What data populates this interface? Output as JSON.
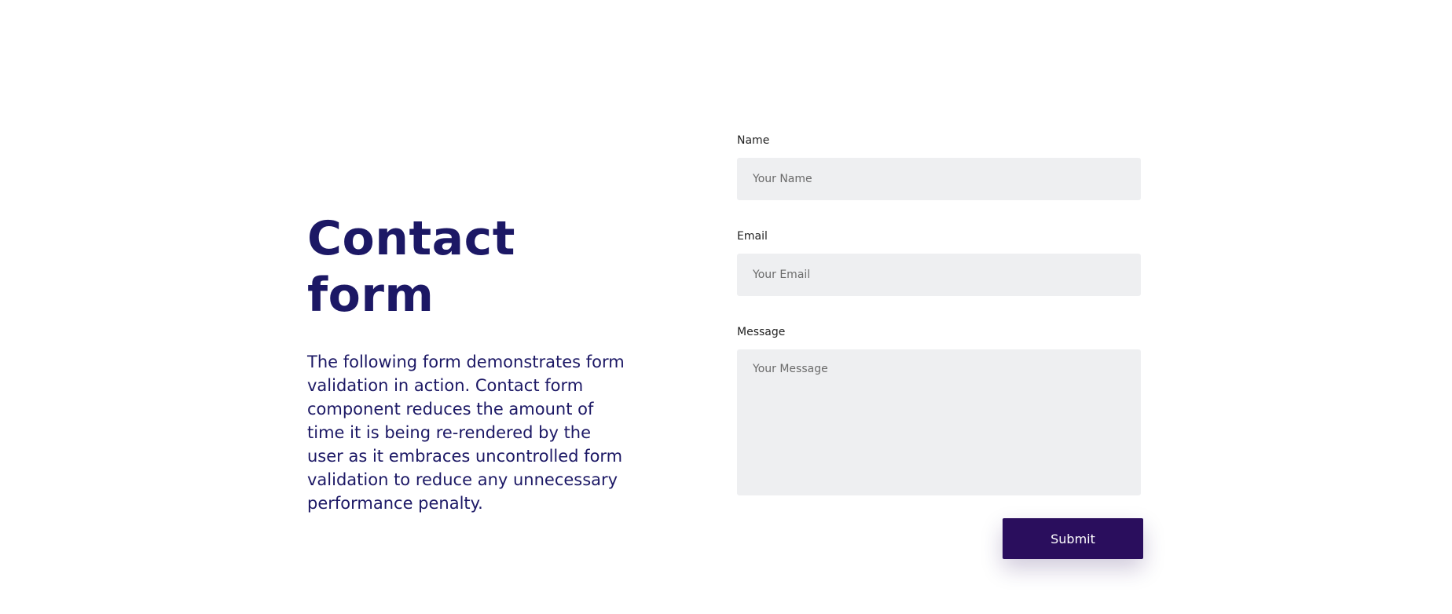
{
  "intro": {
    "title": "Contact form",
    "description": "The following form demonstrates form validation in action. Contact form component reduces the amount of time it is being re-rendered by the user as it embraces uncontrolled form validation to reduce any unnecessary performance penalty."
  },
  "form": {
    "name": {
      "label": "Name",
      "placeholder": "Your Name",
      "value": ""
    },
    "email": {
      "label": "Email",
      "placeholder": "Your Email",
      "value": ""
    },
    "message": {
      "label": "Message",
      "placeholder": "Your Message",
      "value": ""
    },
    "submit_label": "Submit"
  },
  "colors": {
    "heading": "#1c1865",
    "field_background": "#eeeff1",
    "button_background": "#2a0e5d",
    "button_text": "#ffffff"
  }
}
